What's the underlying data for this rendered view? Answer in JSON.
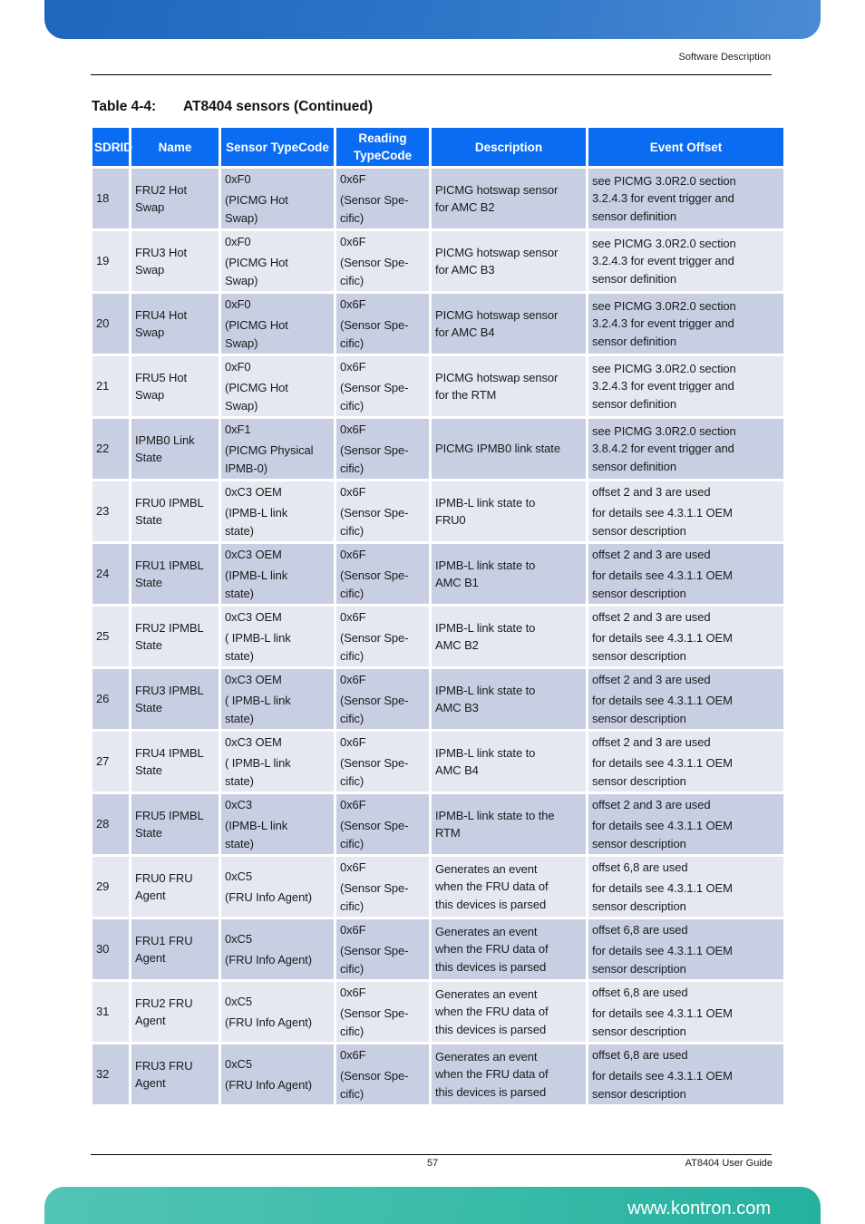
{
  "header": {
    "section": "Software Description"
  },
  "caption": {
    "number": "Table 4-4:",
    "title": "AT8404 sensors (Continued)"
  },
  "table": {
    "columns": [
      "SDR ID",
      "Name",
      "Sensor Type Code",
      "Reading Type Code",
      "Description",
      "Event Offset"
    ],
    "column_lines": [
      [
        "SDR",
        "ID"
      ],
      [
        "Name"
      ],
      [
        "Sensor Type",
        "Code"
      ],
      [
        "Reading Type",
        "Code"
      ],
      [
        "Description"
      ],
      [
        "Event Offset"
      ]
    ],
    "rows": [
      {
        "id": "18",
        "name": [
          "FRU2 Hot",
          "Swap"
        ],
        "sensor_type": [
          "0xF0",
          "(PICMG Hot",
          "Swap)"
        ],
        "reading_type": [
          "0x6F",
          "(Sensor Spe-",
          "cific)"
        ],
        "description": [
          "PICMG hotswap sensor",
          "for AMC B2"
        ],
        "event_offset": [
          "see PICMG 3.0R2.0 section",
          "3.2.4.3 for event trigger and",
          "sensor definition"
        ]
      },
      {
        "id": "19",
        "name": [
          "FRU3 Hot",
          "Swap"
        ],
        "sensor_type": [
          "0xF0",
          "(PICMG Hot",
          "Swap)"
        ],
        "reading_type": [
          "0x6F",
          "(Sensor Spe-",
          "cific)"
        ],
        "description": [
          "PICMG hotswap sensor",
          "for AMC B3"
        ],
        "event_offset": [
          "see PICMG 3.0R2.0 section",
          "3.2.4.3 for event trigger and",
          "sensor definition"
        ]
      },
      {
        "id": "20",
        "name": [
          "FRU4 Hot",
          "Swap"
        ],
        "sensor_type": [
          "0xF0",
          "(PICMG Hot",
          "Swap)"
        ],
        "reading_type": [
          "0x6F",
          "(Sensor Spe-",
          "cific)"
        ],
        "description": [
          "PICMG hotswap sensor",
          "for AMC B4"
        ],
        "event_offset": [
          "see PICMG 3.0R2.0 section",
          "3.2.4.3 for event trigger and",
          "sensor definition"
        ]
      },
      {
        "id": "21",
        "name": [
          "FRU5 Hot",
          "Swap"
        ],
        "sensor_type": [
          "0xF0",
          "(PICMG Hot",
          "Swap)"
        ],
        "reading_type": [
          "0x6F",
          "(Sensor Spe-",
          "cific)"
        ],
        "description": [
          "PICMG hotswap sensor",
          "for the RTM"
        ],
        "event_offset": [
          "see PICMG 3.0R2.0 section",
          "3.2.4.3 for event trigger and",
          "sensor definition"
        ]
      },
      {
        "id": "22",
        "name": [
          "IPMB0 Link",
          "State"
        ],
        "sensor_type": [
          "0xF1",
          "(PICMG Physical",
          "IPMB-0)"
        ],
        "reading_type": [
          "0x6F",
          "(Sensor Spe-",
          "cific)"
        ],
        "description": [
          "PICMG IPMB0 link state"
        ],
        "event_offset": [
          "see PICMG 3.0R2.0 section",
          "3.8.4.2 for event trigger and",
          "sensor definition"
        ]
      },
      {
        "id": "23",
        "name": [
          "FRU0 IPMBL",
          "State"
        ],
        "sensor_type": [
          "0xC3 OEM",
          "(IPMB-L link",
          "state)"
        ],
        "reading_type": [
          "0x6F",
          "(Sensor Spe-",
          "cific)"
        ],
        "description": [
          "IPMB-L link state to",
          "FRU0"
        ],
        "event_offset": [
          "offset 2 and 3 are used",
          "for details see 4.3.1.1 OEM",
          "sensor description"
        ]
      },
      {
        "id": "24",
        "name": [
          "FRU1 IPMBL",
          "State"
        ],
        "sensor_type": [
          "0xC3 OEM",
          "(IPMB-L link",
          "state)"
        ],
        "reading_type": [
          "0x6F",
          "(Sensor Spe-",
          "cific)"
        ],
        "description": [
          "IPMB-L link state to",
          "AMC B1"
        ],
        "event_offset": [
          "offset 2 and 3 are used",
          "for details see 4.3.1.1 OEM",
          "sensor description"
        ]
      },
      {
        "id": "25",
        "name": [
          "FRU2 IPMBL",
          "State"
        ],
        "sensor_type": [
          "0xC3 OEM",
          "( IPMB-L link",
          "state)"
        ],
        "reading_type": [
          "0x6F",
          "(Sensor Spe-",
          "cific)"
        ],
        "description": [
          "IPMB-L link state to",
          "AMC B2"
        ],
        "event_offset": [
          "offset 2 and 3 are used",
          "for details see 4.3.1.1 OEM",
          "sensor description"
        ]
      },
      {
        "id": "26",
        "name": [
          "FRU3 IPMBL",
          "State"
        ],
        "sensor_type": [
          "0xC3 OEM",
          "( IPMB-L link",
          "state)"
        ],
        "reading_type": [
          "0x6F",
          "(Sensor Spe-",
          "cific)"
        ],
        "description": [
          "IPMB-L link state to",
          "AMC B3"
        ],
        "event_offset": [
          "offset 2 and 3 are used",
          "for details see 4.3.1.1 OEM",
          "sensor description"
        ]
      },
      {
        "id": "27",
        "name": [
          "FRU4 IPMBL",
          "State"
        ],
        "sensor_type": [
          "0xC3 OEM",
          "( IPMB-L link",
          "state)"
        ],
        "reading_type": [
          "0x6F",
          "(Sensor Spe-",
          "cific)"
        ],
        "description": [
          "IPMB-L link state to",
          "AMC B4"
        ],
        "event_offset": [
          "offset 2 and 3 are used",
          "for details see 4.3.1.1 OEM",
          "sensor description"
        ]
      },
      {
        "id": "28",
        "name": [
          "FRU5 IPMBL",
          "State"
        ],
        "sensor_type": [
          "0xC3",
          "(IPMB-L link",
          "state)"
        ],
        "reading_type": [
          "0x6F",
          "(Sensor Spe-",
          "cific)"
        ],
        "description": [
          "IPMB-L link state to the",
          "RTM"
        ],
        "event_offset": [
          "offset 2 and 3 are used",
          "for details see 4.3.1.1 OEM",
          "sensor description"
        ]
      },
      {
        "id": "29",
        "name": [
          "FRU0 FRU",
          "Agent"
        ],
        "sensor_type": [
          "0xC5",
          "(FRU Info Agent)"
        ],
        "reading_type": [
          "0x6F",
          "(Sensor Spe-",
          "cific)"
        ],
        "description": [
          "Generates an event",
          "when the FRU data of",
          "this devices is parsed"
        ],
        "event_offset": [
          "offset 6,8 are used",
          "for details see 4.3.1.1 OEM",
          "sensor description"
        ]
      },
      {
        "id": "30",
        "name": [
          "FRU1 FRU",
          "Agent"
        ],
        "sensor_type": [
          "0xC5",
          "(FRU Info Agent)"
        ],
        "reading_type": [
          "0x6F",
          "(Sensor Spe-",
          "cific)"
        ],
        "description": [
          "Generates an event",
          "when the FRU data of",
          "this devices is parsed"
        ],
        "event_offset": [
          "offset 6,8 are used",
          "for details see 4.3.1.1 OEM",
          "sensor description"
        ]
      },
      {
        "id": "31",
        "name": [
          "FRU2 FRU",
          "Agent"
        ],
        "sensor_type": [
          "0xC5",
          "(FRU Info Agent)"
        ],
        "reading_type": [
          "0x6F",
          "(Sensor Spe-",
          "cific)"
        ],
        "description": [
          "Generates an event",
          "when the FRU data of",
          "this devices is parsed"
        ],
        "event_offset": [
          "offset 6,8 are used",
          "for details see 4.3.1.1 OEM",
          "sensor description"
        ]
      },
      {
        "id": "32",
        "name": [
          "FRU3 FRU",
          "Agent"
        ],
        "sensor_type": [
          "0xC5",
          "(FRU Info Agent)"
        ],
        "reading_type": [
          "0x6F",
          "(Sensor Spe-",
          "cific)"
        ],
        "description": [
          "Generates an event",
          "when the FRU data of",
          "this devices is parsed"
        ],
        "event_offset": [
          "offset 6,8 are used",
          "for details see 4.3.1.1 OEM",
          "sensor description"
        ]
      }
    ]
  },
  "footer": {
    "page_number": "57",
    "doc_title": "AT8404 User  Guide",
    "website": "www.kontron.com"
  },
  "colors": {
    "header_cell": "#0a6cf2",
    "row_odd": "#c9cfe3",
    "row_even": "#e6e8f1",
    "top_banner": "#2f76c9",
    "bottom_banner": "#3dbcab"
  }
}
